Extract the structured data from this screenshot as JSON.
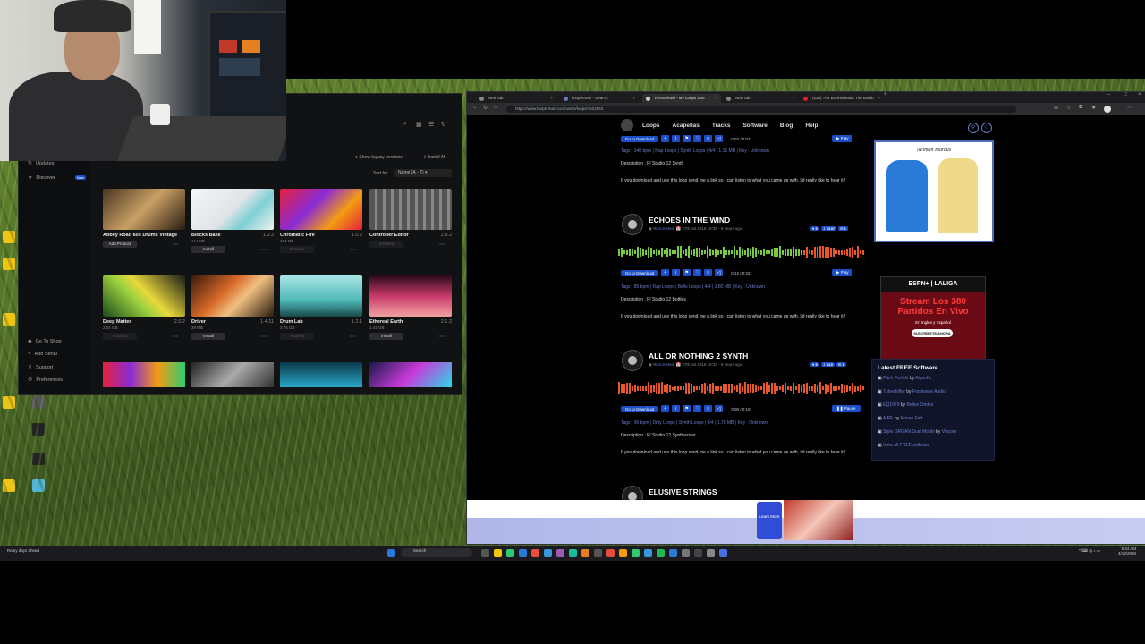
{
  "app": {
    "sidebar": {
      "updates": "Updates",
      "discover": "Discover",
      "discover_badge": "New",
      "go_to_shop": "Go To Shop",
      "add_serial": "Add Serial",
      "support": "Support",
      "preferences": "Preferences"
    },
    "toolbar": {
      "show_legacy": "Show legacy versions",
      "install_all": "Install All",
      "sort_by_label": "Sort by:",
      "sort_value": "Name (A - Z)"
    },
    "products": [
      {
        "name": "Abbey Road 60s Drums Vintage",
        "version": "",
        "size": "",
        "button": "Add Product",
        "state": "install"
      },
      {
        "name": "Blocks Base",
        "version": "1.0.3",
        "size": "114 MB",
        "button": "Install",
        "state": "install"
      },
      {
        "name": "Chromatic Fire",
        "version": "1.0.2",
        "size": "494 MB",
        "button": "Installed",
        "state": "installed"
      },
      {
        "name": "Controller Editor",
        "version": "2.8.2",
        "size": "",
        "button": "Installed",
        "state": "installed"
      },
      {
        "name": "Deep Matter",
        "version": "2.0.2",
        "size": "2.04 GB",
        "button": "Installed",
        "state": "installed"
      },
      {
        "name": "Driver",
        "version": "1.4.11",
        "size": "39 MB",
        "button": "Install",
        "state": "install"
      },
      {
        "name": "Drum Lab",
        "version": "1.2.1",
        "size": "3.75 GB",
        "button": "Installed",
        "state": "installed"
      },
      {
        "name": "Ethereal Earth",
        "version": "2.1.2",
        "size": "1.41 GB",
        "button": "Install",
        "state": "install"
      }
    ]
  },
  "browser": {
    "tabs": [
      {
        "label": "New tab",
        "active": false
      },
      {
        "label": "looperman - Search",
        "active": false
      },
      {
        "label": "Rezumkted - My Loops Sou",
        "active": true
      },
      {
        "label": "New tab",
        "active": false
      },
      {
        "label": "(225) The Bucketheads The Bomb",
        "active": false
      }
    ],
    "url": "https://www.looperman.com/users/loops/1522653",
    "site_nav": [
      "Loops",
      "Acapellas",
      "Tracks",
      "Software",
      "Blog",
      "Help"
    ],
    "top_loop": {
      "go_to_download": "Go to Download",
      "time": "0:02 / 0:07",
      "play": "Play",
      "tags": "Tags : 140 bpm | Rap Loops | Synth Loops | 4/4 | 1.15 MB | Key : Unknown",
      "description": "Description : FI Studio 12 Synth",
      "note": "If you download and use this loop send me a link so I can listen to what you came up with, I'd really like to hear it!!"
    },
    "loops": [
      {
        "title": "ECHOES IN THE WIND",
        "author": "Rezumkted",
        "meta": "27th Jul 2016 16:35 - 9 years ago",
        "likes": "5",
        "downloads": "2197",
        "comments": "1",
        "go_to_download": "Go to Download",
        "time": "0:12 / 0:23",
        "play": "Play",
        "tags": "Tags : 85 bpm | Rap Loops | Bells Loops | 4/4 | 3.80 MB | Key : Unknown",
        "description": "Description : FI Studio 12 Bottles",
        "note": "If you download and use this loop send me a link so I can listen to what you came up with, I'd really like to hear it!!"
      },
      {
        "title": "ALL OR NOTHING 2 SYNTH",
        "author": "Rezumkted",
        "meta": "27th Jul 2016 16:33 - 9 years ago",
        "likes": "5",
        "downloads": "415",
        "comments": "1",
        "go_to_download": "Go to Download",
        "time": "0:00 / 0:10",
        "play": "Pause",
        "tags": "Tags : 90 bpm | Dirty Loops | Synth Loops | 4/4 | 1.70 MB | Key : Unknown",
        "description": "Description : FI Studio 12 Synthesizer",
        "note": "If you download and use this loop send me a link so I can listen to what you came up with, I'd really like to hear it!!"
      }
    ],
    "next_loop_title": "ELUSIVE STRINGS",
    "ads": {
      "ad1_brand": "Neiman Marcus",
      "ad2_top": "ESPN+ | LALIGA",
      "ad2_headline": "Stream Los 380 Partidos En Vivo",
      "ad2_sub": "En Inglés y Español",
      "ad2_button": "SUSCRÍBETE AHORA",
      "bottom_learn": "Learn More"
    },
    "free_software": {
      "title": "Latest FREE Software",
      "items": [
        {
          "name": "Pitch Perfekt",
          "by": "by",
          "vendor": "Algonfix"
        },
        {
          "name": "Tubeshifter",
          "by": "by",
          "vendor": "Frostwave Audio"
        },
        {
          "name": "EQ1979",
          "by": "by",
          "vendor": "Belles Ondes"
        },
        {
          "name": "AIRE",
          "by": "by",
          "vendor": "Ronan Fed"
        },
        {
          "name": "Style ORGAN Dual Model",
          "by": "by",
          "vendor": "Viscore"
        },
        {
          "name": "View all FREE software",
          "by": "",
          "vendor": ""
        }
      ]
    }
  },
  "taskbar": {
    "weather": "Rainy days ahead",
    "search": "Search",
    "time": "9:34 AM",
    "date": "4/18/2026"
  },
  "colors": {
    "accent_blue": "#1c4fc7",
    "wave_green": "#7ac943",
    "wave_orange": "#e8582a",
    "link": "#6d7cc7"
  }
}
